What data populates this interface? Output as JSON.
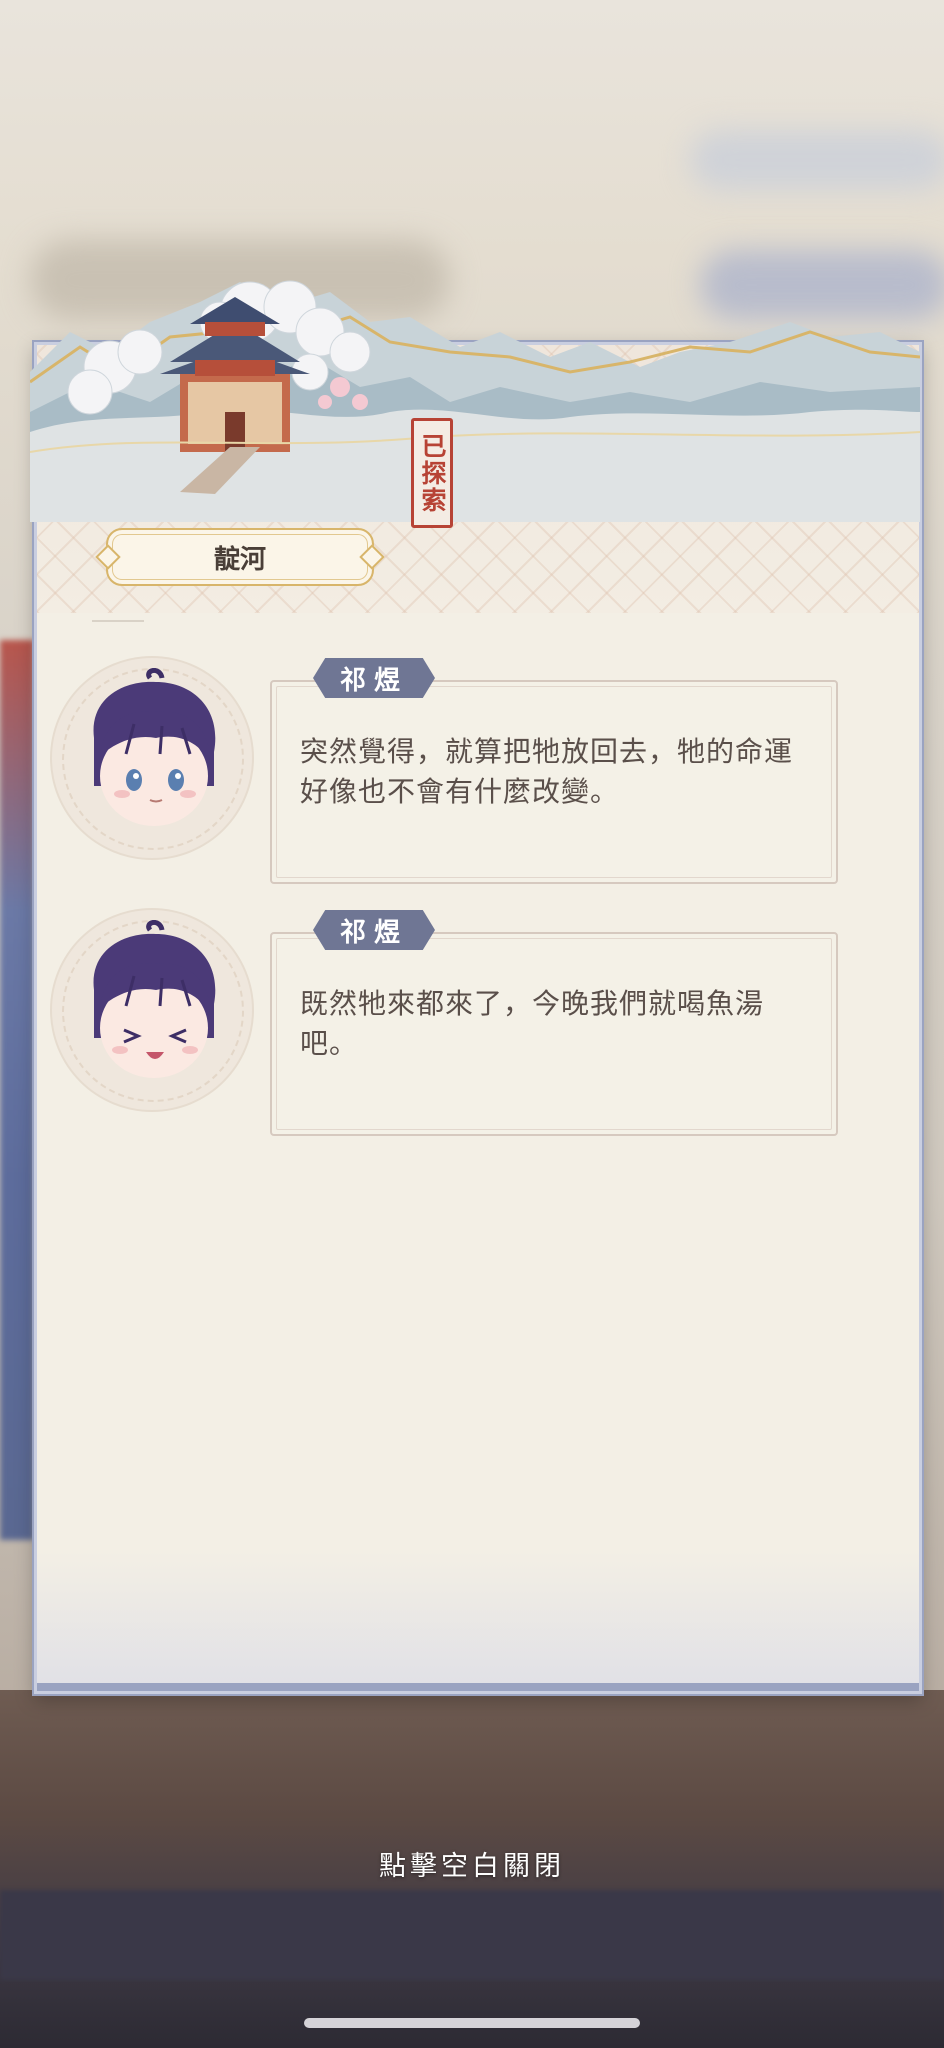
{
  "location": {
    "name": "靛河",
    "status_seal": "已探索"
  },
  "dialogue": [
    {
      "speaker": "祁煜",
      "text": "突然覺得，就算把牠放回去，牠的命運好像也不會有什麼改變。",
      "expression": "neutral"
    },
    {
      "speaker": "祁煜",
      "text": "既然牠來都來了，今晚我們就喝魚湯吧。",
      "expression": "happy"
    }
  ],
  "close_hint": "點擊空白關閉",
  "colors": {
    "name_tag": "#6f7694",
    "seal": "#b74335",
    "tag_border": "#d8b56a",
    "card_bg": "#f3efe5",
    "hair": "#4b3a78"
  }
}
